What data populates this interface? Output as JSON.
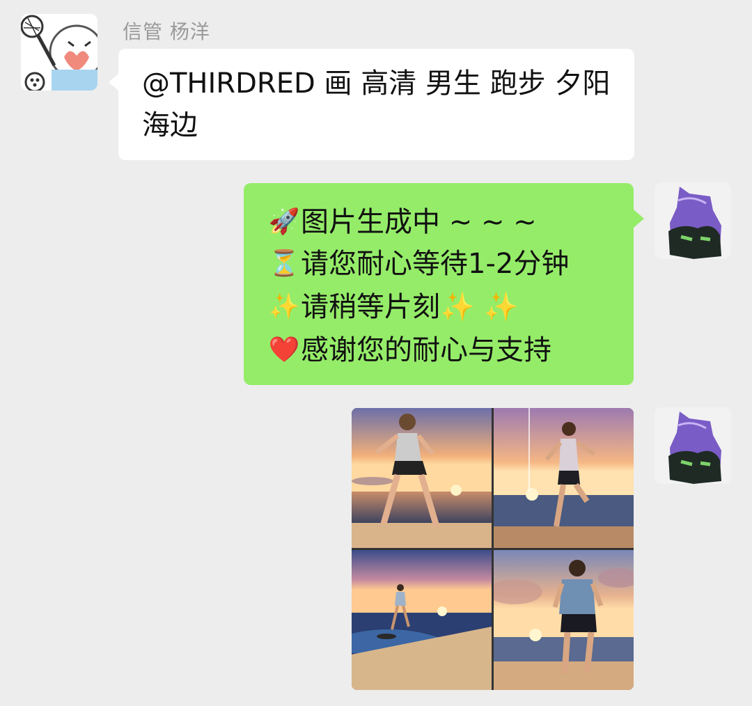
{
  "chat": {
    "incoming": {
      "sender_name": "信管 杨洋",
      "text": "@THIRDRED  画 高清 男生 跑步 夕阳 海边"
    },
    "outgoing_text": {
      "lines": [
        {
          "emoji": "🚀",
          "text": "图片生成中 ~ ~ ~"
        },
        {
          "emoji": "⏳",
          "text": "请您耐心等待1-2分钟"
        },
        {
          "emoji": "✨",
          "text": "请稍等片刻✨ ✨"
        },
        {
          "emoji": "❤️",
          "text": "感谢您的耐心与支持"
        }
      ]
    },
    "outgoing_image": {
      "panels": [
        "runner-beach-sunset-1",
        "runner-beach-sunset-2",
        "runner-beach-sunset-3",
        "runner-beach-sunset-4"
      ]
    }
  },
  "colors": {
    "background": "#ededed",
    "incoming_bubble": "#ffffff",
    "outgoing_bubble": "#95ec69",
    "sender_name": "#9a9a9a"
  }
}
